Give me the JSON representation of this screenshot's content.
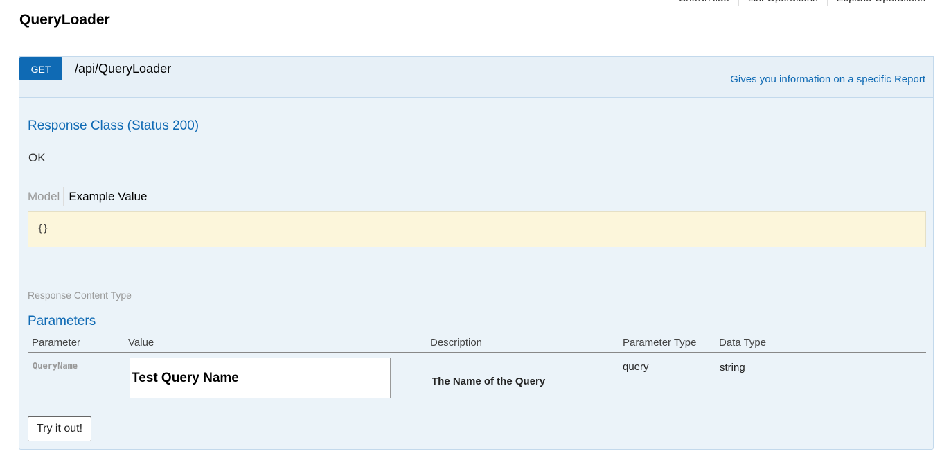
{
  "header": {
    "links": [
      "Show/Hide",
      "List Operations",
      "Expand Operations"
    ],
    "resource_title": "QueryLoader"
  },
  "operation": {
    "verb": "GET",
    "path": "/api/QueryLoader",
    "summary": "Gives you information on a specific Report",
    "response_class_title": "Response Class (Status 200)",
    "response_status_text": "OK",
    "tabs": {
      "model": "Model",
      "example_value": "Example Value"
    },
    "example_snippet": "{}",
    "response_content_type_label": "Response Content Type",
    "parameters_title": "Parameters",
    "parameter_headers": [
      "Parameter",
      "Value",
      "Description",
      "Parameter Type",
      "Data Type"
    ],
    "parameters": [
      {
        "name": "QueryName",
        "value": "Test Query Name",
        "description": "The Name of the Query",
        "param_type": "query",
        "data_type": "string"
      }
    ],
    "try_button_label": "Try it out!"
  },
  "colors": {
    "accent": "#0f6ab4",
    "op_background": "#ebf3f9",
    "snippet_background": "#fcf6db"
  }
}
